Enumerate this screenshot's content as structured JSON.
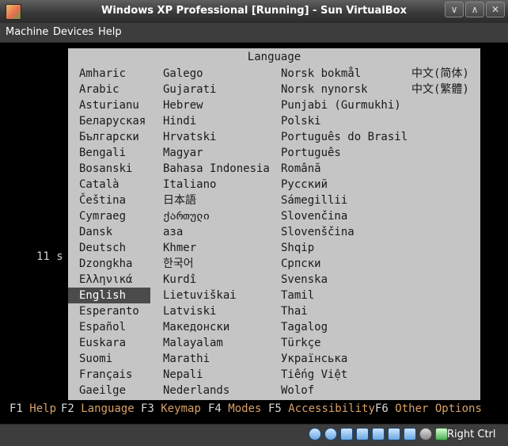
{
  "window": {
    "title": "Windows XP Professional [Running] - Sun VirtualBox",
    "buttons": [
      "∨",
      "∧",
      "✕"
    ]
  },
  "menu": [
    "Machine",
    "Devices",
    "Help"
  ],
  "boot": {
    "header": "Language",
    "countdown": "11 s",
    "selected": "English",
    "columns": [
      [
        "Amharic",
        "Arabic",
        "Asturianu",
        "Беларуская",
        "Български",
        "Bengali",
        "Bosanski",
        "Català",
        "Čeština",
        "Cymraeg",
        "Dansk",
        "Deutsch",
        "Dzongkha",
        "Ελληνικά",
        "English",
        "Esperanto",
        "Español",
        "Euskara",
        "Suomi",
        "Français",
        "Gaeilge"
      ],
      [
        "Galego",
        "Gujarati",
        "Hebrew",
        "Hindi",
        "Hrvatski",
        "Magyar",
        "Bahasa Indonesia",
        "Italiano",
        "日本語",
        "ქართული",
        "аза",
        "Khmer",
        "한국어",
        "Kurdî",
        "Lietuviškai",
        "Latviski",
        "Македонски",
        "Malayalam",
        "Marathi",
        "Nepali",
        "Nederlands"
      ],
      [
        "Norsk bokmål",
        "Norsk nynorsk",
        "Punjabi (Gurmukhi)",
        "Polski",
        "Português do Brasil",
        "Português",
        "Română",
        "Русский",
        "Sámegillii",
        "Slovenčina",
        "Slovenščina",
        "Shqip",
        "Српски",
        "Svenska",
        "Tamil",
        "Thai",
        "Tagalog",
        "Türkçe",
        "Українська",
        "Tiếng Việt",
        "Wolof"
      ],
      [
        "中文(简体)",
        "中文(繁體)"
      ]
    ],
    "fkeys": [
      {
        "key": "F1",
        "label": "Help"
      },
      {
        "key": "F2",
        "label": "Language"
      },
      {
        "key": "F3",
        "label": "Keymap"
      },
      {
        "key": "F4",
        "label": "Modes"
      },
      {
        "key": "F5",
        "label": "Accessibility"
      },
      {
        "key": "F6",
        "label": "Other Options"
      }
    ]
  },
  "status": {
    "icons": [
      "hard-disk-icon",
      "cd-icon",
      "floppy-icon",
      "usb-icon",
      "shared-folder-icon",
      "network-icon",
      "vrdp-icon",
      "mouse-integration-icon",
      "host-key-icon"
    ],
    "host_key": "Right Ctrl"
  }
}
